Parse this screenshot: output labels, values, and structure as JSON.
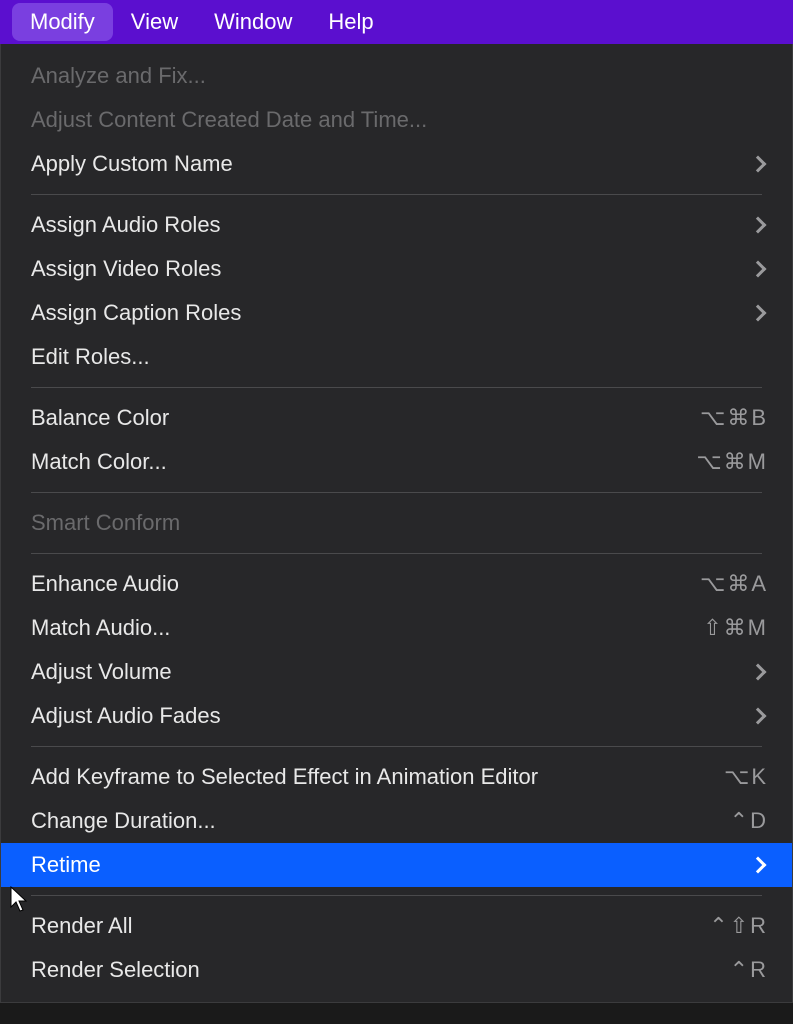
{
  "menubar": {
    "items": [
      {
        "label": "Modify",
        "active": true
      },
      {
        "label": "View",
        "active": false
      },
      {
        "label": "Window",
        "active": false
      },
      {
        "label": "Help",
        "active": false
      }
    ]
  },
  "dropdown": {
    "groups": [
      [
        {
          "label": "Analyze and Fix...",
          "disabled": true
        },
        {
          "label": "Adjust Content Created Date and Time...",
          "disabled": true
        },
        {
          "label": "Apply Custom Name",
          "submenu": true
        }
      ],
      [
        {
          "label": "Assign Audio Roles",
          "submenu": true
        },
        {
          "label": "Assign Video Roles",
          "submenu": true
        },
        {
          "label": "Assign Caption Roles",
          "submenu": true
        },
        {
          "label": "Edit Roles..."
        }
      ],
      [
        {
          "label": "Balance Color",
          "shortcut": "⌥⌘B"
        },
        {
          "label": "Match Color...",
          "shortcut": "⌥⌘M"
        }
      ],
      [
        {
          "label": "Smart Conform",
          "disabled": true
        }
      ],
      [
        {
          "label": "Enhance Audio",
          "shortcut": "⌥⌘A"
        },
        {
          "label": "Match Audio...",
          "shortcut": "⇧⌘M"
        },
        {
          "label": "Adjust Volume",
          "submenu": true
        },
        {
          "label": "Adjust Audio Fades",
          "submenu": true
        }
      ],
      [
        {
          "label": "Add Keyframe to Selected Effect in Animation Editor",
          "shortcut": "⌥K"
        },
        {
          "label": "Change Duration...",
          "shortcut": "⌃D"
        },
        {
          "label": "Retime",
          "submenu": true,
          "highlighted": true
        }
      ],
      [
        {
          "label": "Render All",
          "shortcut": "⌃⇧R"
        },
        {
          "label": "Render Selection",
          "shortcut": "⌃R"
        }
      ]
    ]
  }
}
